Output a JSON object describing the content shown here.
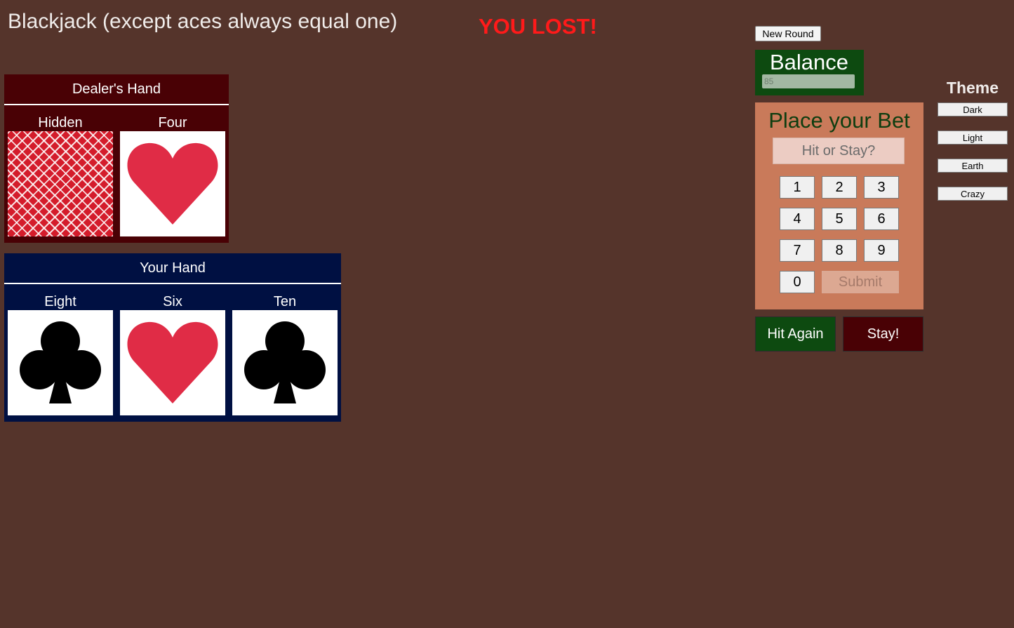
{
  "header": {
    "title": "Blackjack (except aces always equal one)",
    "result": "YOU LOST!"
  },
  "colors": {
    "background": "#55342b",
    "dealer_panel": "#490105",
    "player_panel": "#001042",
    "balance_panel": "#0d4a10",
    "bet_panel": "#c97a5a",
    "result_text": "#ff1a1a",
    "heart": "#e02c46",
    "club": "#000000"
  },
  "dealer": {
    "title": "Dealer's Hand",
    "cards": [
      {
        "label": "Hidden",
        "suit": "card-back"
      },
      {
        "label": "Four",
        "suit": "heart-icon"
      }
    ]
  },
  "player": {
    "title": "Your Hand",
    "cards": [
      {
        "label": "Eight",
        "suit": "club-icon"
      },
      {
        "label": "Six",
        "suit": "heart-icon"
      },
      {
        "label": "Ten",
        "suit": "club-icon"
      }
    ]
  },
  "controls": {
    "new_round": "New Round",
    "balance_title": "Balance",
    "balance_value": "85",
    "bet_title": "Place your Bet",
    "bet_placeholder": "Hit or Stay?",
    "keys": [
      "1",
      "2",
      "3",
      "4",
      "5",
      "6",
      "7",
      "8",
      "9",
      "0"
    ],
    "submit": "Submit",
    "hit": "Hit Again",
    "stay": "Stay!"
  },
  "theme": {
    "title": "Theme",
    "options": [
      "Dark",
      "Light",
      "Earth",
      "Crazy"
    ]
  }
}
